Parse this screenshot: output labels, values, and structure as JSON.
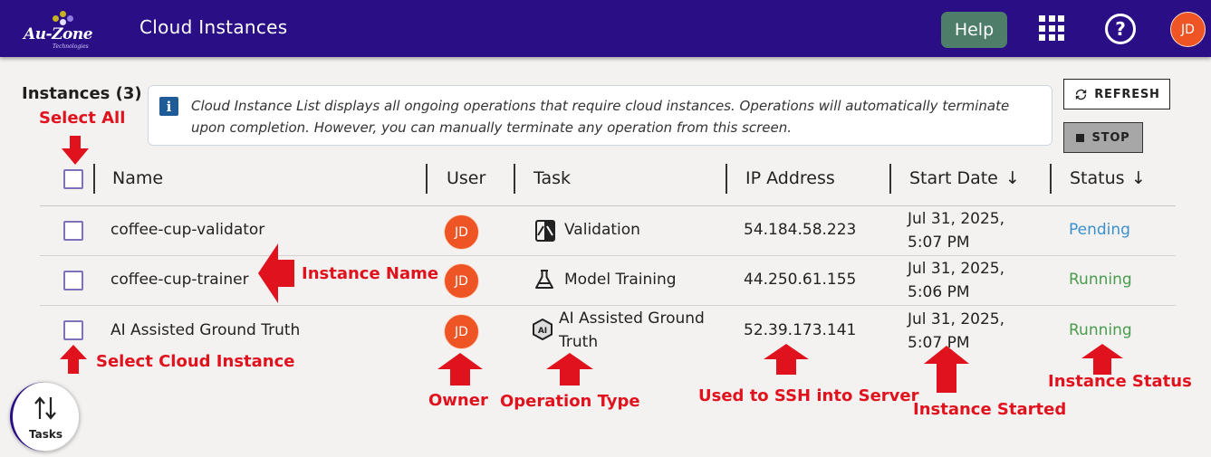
{
  "header": {
    "logo_text": "Au-Zone",
    "logo_sub": "Technologies",
    "title": "Cloud Instances",
    "help_label": "Help",
    "user_initials": "JD"
  },
  "instances": {
    "title": "Instances (3)",
    "info_text": "Cloud Instance List displays all ongoing operations that require cloud instances. Operations will automatically terminate upon completion. However, you can manually terminate any operation from this screen."
  },
  "buttons": {
    "refresh_label": "REFRESH",
    "stop_label": "STOP"
  },
  "table": {
    "columns": {
      "name": "Name",
      "user": "User",
      "task": "Task",
      "ip": "IP Address",
      "start": "Start Date",
      "status": "Status"
    },
    "sort_arrow": "↓",
    "rows": [
      {
        "name": "coffee-cup-validator",
        "user": "JD",
        "task": "Validation",
        "task_icon": "validation-icon",
        "ip": "54.184.58.223",
        "date": "Jul 31, 2025,",
        "time": "5:07 PM",
        "status": "Pending",
        "status_color": "#3a8fcc"
      },
      {
        "name": "coffee-cup-trainer",
        "user": "JD",
        "task": "Model Training",
        "task_icon": "flask-icon",
        "ip": "44.250.61.155",
        "date": "Jul 31, 2025,",
        "time": "5:06 PM",
        "status": "Running",
        "status_color": "#4a9c4e"
      },
      {
        "name": "AI Assisted Ground Truth",
        "user": "JD",
        "task_line1": "AI Assisted Ground",
        "task_line2": "Truth",
        "task_icon": "ai-hexagon-icon",
        "ip": "52.39.173.141",
        "date": "Jul 31, 2025,",
        "time": "5:07 PM",
        "status": "Running",
        "status_color": "#4a9c4e"
      }
    ]
  },
  "annotations": {
    "select_all": "Select All",
    "instance_name": "Instance Name",
    "select_instance": "Select Cloud Instance",
    "owner": "Owner",
    "operation_type": "Operation Type",
    "ssh": "Used to SSH into Server",
    "instance_started": "Instance Started",
    "instance_status": "Instance Status"
  },
  "tasks_fab": {
    "label": "Tasks"
  },
  "colors": {
    "topbar": "#2a0e86",
    "help": "#4e7d6a",
    "avatar": "#ee5424",
    "annotation": "#e0121e",
    "pending": "#3a8fcc",
    "running": "#4a9c4e"
  }
}
